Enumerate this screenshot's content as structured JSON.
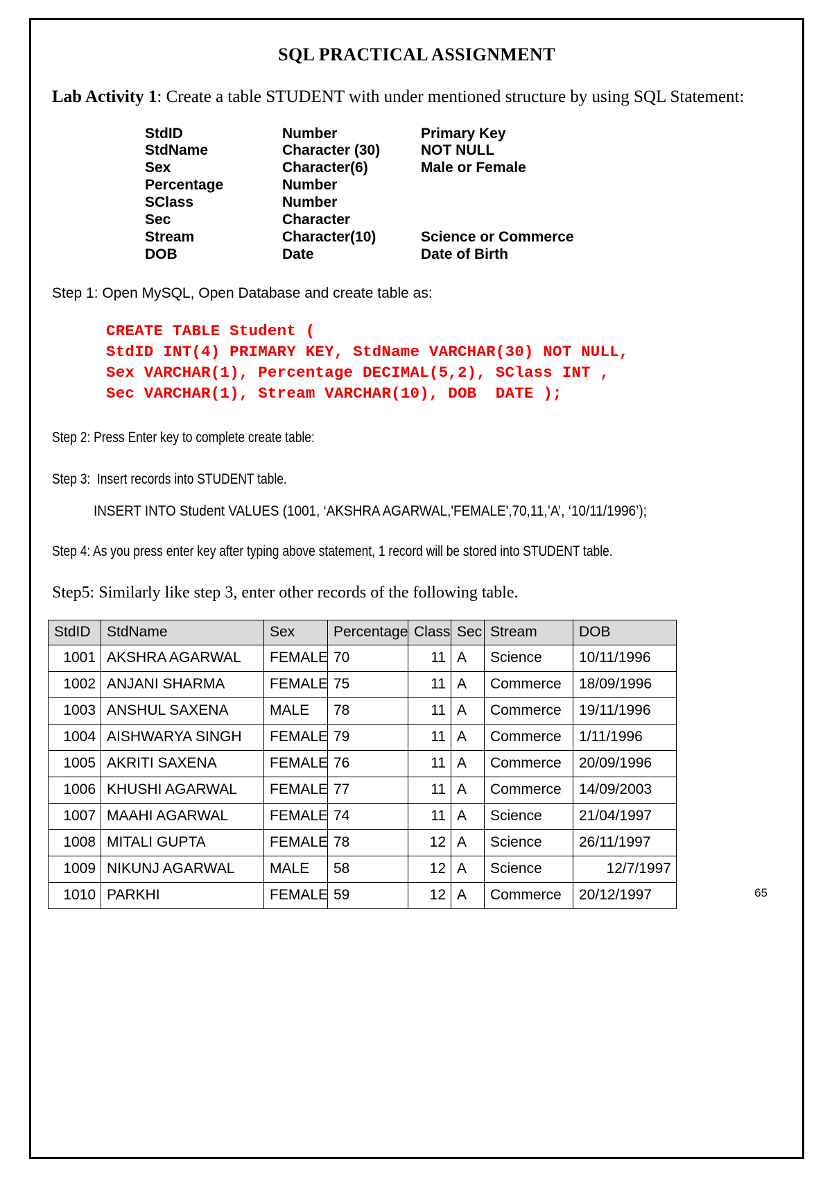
{
  "document": {
    "title": "SQL PRACTICAL ASSIGNMENT",
    "page_number": "65"
  },
  "lab_activity": {
    "label": "Lab Activity 1",
    "text": ": Create a table STUDENT with under mentioned structure by using SQL Statement:"
  },
  "structure": {
    "rows": [
      {
        "field": "StdID",
        "type": "Number",
        "note": "Primary Key"
      },
      {
        "field": "StdName",
        "type": "Character (30)",
        "note": "NOT NULL"
      },
      {
        "field": "Sex",
        "type": "Character(6)",
        "note": "Male or Female"
      },
      {
        "field": "Percentage",
        "type": "Number",
        "note": ""
      },
      {
        "field": "SClass",
        "type": "Number",
        "note": ""
      },
      {
        "field": "Sec",
        "type": "Character",
        "note": ""
      },
      {
        "field": "Stream",
        "type": "Character(10)",
        "note": "Science or Commerce"
      },
      {
        "field": "DOB",
        "type": "Date",
        "note": "Date of Birth"
      }
    ]
  },
  "steps": {
    "step1": "Step 1: Open MySQL, Open Database and create table as:",
    "sql_code": "CREATE TABLE Student (\nStdID INT(4) PRIMARY KEY, StdName VARCHAR(30) NOT NULL,\nSex VARCHAR(1), Percentage DECIMAL(5,2), SClass INT ,\nSec VARCHAR(1), Stream VARCHAR(10), DOB  DATE );",
    "sql_color": "#ee0000",
    "step2": "Step 2: Press Enter key to complete create table:",
    "step3": "Step 3:  Insert records into STUDENT table.",
    "step3_insert": "INSERT INTO Student VALUES (1001, ‘AKSHRA AGARWAL,'FEMALE',70,11,’A’, ‘10/11/1996’);",
    "step4": "Step 4: As you press enter key after typing above statement, 1 record will be stored into STUDENT table.",
    "step5": "Step5: Similarly like step 3, enter other records of the following table."
  },
  "table": {
    "header_background": "#dadada",
    "columns": [
      "StdID",
      "StdName",
      "Sex",
      "Percentage",
      "Class",
      "Sec",
      "Stream",
      "DOB"
    ],
    "rows": [
      {
        "stdid": "1001",
        "stdname": "AKSHRA AGARWAL",
        "sex": "FEMALE",
        "percentage": "70",
        "class": "11",
        "sec": "A",
        "stream": "Science",
        "dob": "10/11/1996"
      },
      {
        "stdid": "1002",
        "stdname": "ANJANI SHARMA",
        "sex": "FEMALE",
        "percentage": "75",
        "class": "11",
        "sec": "A",
        "stream": "Commerce",
        "dob": "18/09/1996"
      },
      {
        "stdid": "1003",
        "stdname": "ANSHUL SAXENA",
        "sex": "MALE",
        "percentage": "78",
        "class": "11",
        "sec": "A",
        "stream": "Commerce",
        "dob": "19/11/1996"
      },
      {
        "stdid": "1004",
        "stdname": "AISHWARYA SINGH",
        "sex": "FEMALE",
        "percentage": "79",
        "class": "11",
        "sec": "A",
        "stream": "Commerce",
        "dob": "1/11/1996"
      },
      {
        "stdid": "1005",
        "stdname": "AKRITI SAXENA",
        "sex": "FEMALE",
        "percentage": "76",
        "class": "11",
        "sec": "A",
        "stream": "Commerce",
        "dob": "20/09/1996"
      },
      {
        "stdid": "1006",
        "stdname": "KHUSHI AGARWAL",
        "sex": "FEMALE",
        "percentage": "77",
        "class": "11",
        "sec": "A",
        "stream": "Commerce",
        "dob": "14/09/2003"
      },
      {
        "stdid": "1007",
        "stdname": "MAAHI AGARWAL",
        "sex": "FEMALE",
        "percentage": "74",
        "class": "11",
        "sec": "A",
        "stream": "Science",
        "dob": "21/04/1997"
      },
      {
        "stdid": "1008",
        "stdname": "MITALI GUPTA",
        "sex": "FEMALE",
        "percentage": "78",
        "class": "12",
        "sec": "A",
        "stream": "Science",
        "dob": "26/11/1997"
      },
      {
        "stdid": "1009",
        "stdname": "NIKUNJ AGARWAL",
        "sex": "MALE",
        "percentage": "58",
        "class": "12",
        "sec": "A",
        "stream": "Science",
        "dob": "12/7/1997"
      },
      {
        "stdid": "1010",
        "stdname": "PARKHI",
        "sex": "FEMALE",
        "percentage": "59",
        "class": "12",
        "sec": "A",
        "stream": "Commerce",
        "dob": "20/12/1997"
      }
    ]
  }
}
